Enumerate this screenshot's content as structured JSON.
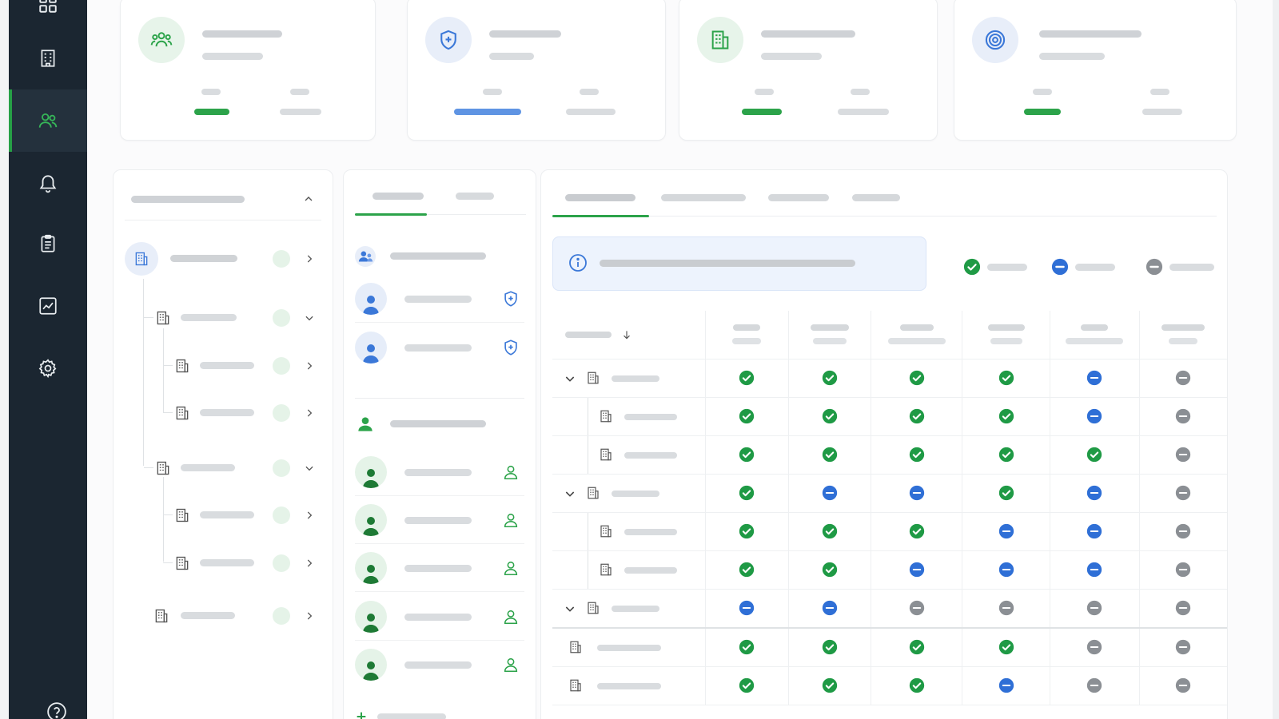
{
  "sidebar": {
    "items": [
      {
        "icon": "dashboard-icon"
      },
      {
        "icon": "building-icon"
      },
      {
        "icon": "users-icon",
        "active": true
      },
      {
        "icon": "bell-icon"
      },
      {
        "icon": "clipboard-icon"
      },
      {
        "icon": "chart-line-icon"
      },
      {
        "icon": "gear-icon"
      }
    ],
    "bottom_icon": "help-icon"
  },
  "stat_cards": [
    {
      "icon": "team-icon",
      "accent": "#2ca34a",
      "progress_color": "green"
    },
    {
      "icon": "shield-plus-icon",
      "accent": "#4f86de",
      "progress_color": "blue"
    },
    {
      "icon": "building-icon",
      "accent": "#2ca34a",
      "progress_color": "green"
    },
    {
      "icon": "target-icon",
      "accent": "#4f86de",
      "progress_color": "green"
    }
  ],
  "org_tree": {
    "nodes": [
      {
        "level": 0,
        "expanded": false,
        "selected": true
      },
      {
        "level": 1,
        "expanded": true
      },
      {
        "level": 2,
        "expanded": false
      },
      {
        "level": 2,
        "expanded": false
      },
      {
        "level": 1,
        "expanded": true
      },
      {
        "level": 2,
        "expanded": false
      },
      {
        "level": 2,
        "expanded": false
      },
      {
        "level": 1,
        "expanded": false
      }
    ]
  },
  "users_panel": {
    "active_tab": 0,
    "groups": [
      {
        "icon": "user-group-icon",
        "members": [
          {
            "badge": "shield-plus-icon"
          },
          {
            "badge": "shield-plus-icon"
          }
        ]
      },
      {
        "icon": "user-icon",
        "members": [
          {
            "badge": "user-outline-icon"
          },
          {
            "badge": "user-outline-icon"
          },
          {
            "badge": "user-outline-icon"
          },
          {
            "badge": "user-outline-icon"
          },
          {
            "badge": "user-outline-icon"
          }
        ]
      }
    ]
  },
  "permissions": {
    "active_tab": 0,
    "legend": [
      {
        "status": "check",
        "color": "#1f9a45"
      },
      {
        "status": "partial",
        "color": "#2f6fd6"
      },
      {
        "status": "none",
        "color": "#8b8f94"
      }
    ],
    "rows": [
      {
        "level": 0,
        "expandable": true,
        "cells": [
          "check",
          "check",
          "check",
          "check",
          "partial",
          "none"
        ]
      },
      {
        "level": 1,
        "cells": [
          "check",
          "check",
          "check",
          "check",
          "partial",
          "none"
        ]
      },
      {
        "level": 1,
        "cells": [
          "check",
          "check",
          "check",
          "check",
          "check",
          "none"
        ]
      },
      {
        "level": 0,
        "expandable": true,
        "cells": [
          "check",
          "partial",
          "partial",
          "check",
          "partial",
          "none"
        ]
      },
      {
        "level": 1,
        "cells": [
          "check",
          "check",
          "check",
          "partial",
          "partial",
          "none"
        ]
      },
      {
        "level": 1,
        "cells": [
          "check",
          "check",
          "partial",
          "partial",
          "partial",
          "none"
        ]
      },
      {
        "level": 0,
        "expandable": true,
        "cells": [
          "partial",
          "partial",
          "none",
          "none",
          "none",
          "none"
        ]
      },
      {
        "level": -1,
        "cells": [
          "check",
          "check",
          "check",
          "check",
          "none",
          "none"
        ]
      },
      {
        "level": -1,
        "cells": [
          "check",
          "check",
          "check",
          "partial",
          "none",
          "none"
        ]
      }
    ]
  }
}
